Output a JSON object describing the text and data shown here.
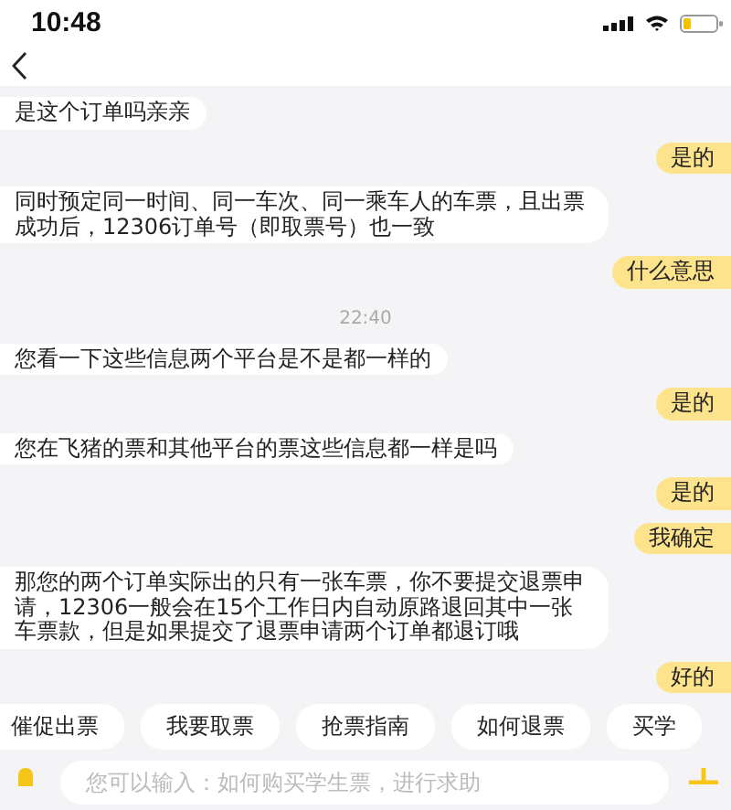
{
  "status_bar": {
    "time": "10:48"
  },
  "messages": [
    {
      "kind": "received",
      "text": "是这个订单吗亲亲"
    },
    {
      "kind": "sent",
      "text": "是的"
    },
    {
      "kind": "received",
      "text": "同时预定同一时间、同一车次、同一乘车人的车票，且出票成功后，12306订单号（即取票号）也一致"
    },
    {
      "kind": "sent",
      "text": "什么意思"
    },
    {
      "kind": "timestamp",
      "text": "22:40"
    },
    {
      "kind": "received",
      "text": "您看一下这些信息两个平台是不是都一样的"
    },
    {
      "kind": "sent",
      "text": "是的"
    },
    {
      "kind": "received",
      "text": "您在飞猪的票和其他平台的票这些信息都一样是吗"
    },
    {
      "kind": "sent",
      "text": "是的"
    },
    {
      "kind": "sent",
      "text": "我确定"
    },
    {
      "kind": "received",
      "text": "那您的两个订单实际出的只有一张车票，你不要提交退票申请，12306一般会在15个工作日内自动原路退回其中一张车票款，但是如果提交了退票申请两个订单都退订哦"
    },
    {
      "kind": "sent",
      "text": "好的"
    }
  ],
  "quick_replies": [
    "催促出票",
    "我要取票",
    "抢票指南",
    "如何退票",
    "买学"
  ],
  "input": {
    "placeholder": "您可以输入：如何购买学生票，进行求助"
  }
}
